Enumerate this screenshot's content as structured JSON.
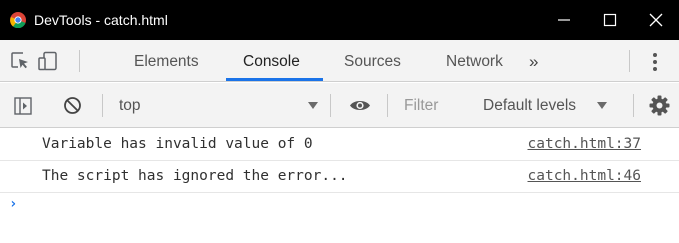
{
  "window": {
    "title": "DevTools - catch.html",
    "icon": "chrome-logo-icon",
    "controls": [
      "minimize-icon",
      "maximize-icon",
      "close-icon"
    ]
  },
  "tabs": {
    "inspect_icon": "inspect-element-icon",
    "device_icon": "device-toggle-icon",
    "items": [
      {
        "label": "Elements",
        "active": false
      },
      {
        "label": "Console",
        "active": true
      },
      {
        "label": "Sources",
        "active": false
      },
      {
        "label": "Network",
        "active": false
      }
    ],
    "more_label": "»",
    "menu_icon": "kebab-menu-icon"
  },
  "console_toolbar": {
    "sidebar_icon": "show-sidebar-icon",
    "clear_icon": "clear-console-icon",
    "context_value": "top",
    "eye_icon": "live-expression-eye-icon",
    "filter_placeholder": "Filter",
    "levels_label": "Default levels",
    "settings_icon": "gear-icon"
  },
  "messages": [
    {
      "text": "Variable has invalid value of 0",
      "source": "catch.html:37"
    },
    {
      "text": "The script has ignored the error...",
      "source": "catch.html:46"
    }
  ],
  "prompt": {
    "glyph": "›"
  },
  "colors": {
    "titlebar": "#000000",
    "toolbar": "#f3f3f3",
    "accent": "#1a73e8"
  }
}
